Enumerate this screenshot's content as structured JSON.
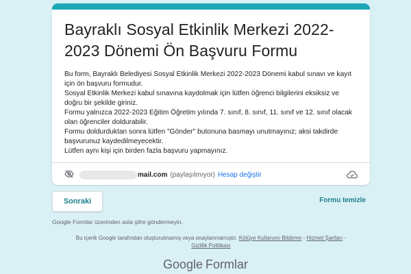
{
  "form": {
    "title": "Bayraklı Sosyal Etkinlik Merkezi 2022-2023 Dönemi Ön Başvuru Formu",
    "description": [
      "Bu form, Bayraklı Belediyesi Sosyal Etkinlik Merkezi 2022-2023 Dönemi kabul sınavı ve kayıt için ön başvuru formudur.",
      "Sosyal Etkinlik Merkezi kabul sınavına kaydolmak için lütfen öğrenci bilgilerini eksiksiz ve doğru bir şekilde giriniz.",
      "Formu yalnızca 2022-2023 Eğitim Öğretim yılında 7. sınıf, 8. sınıf, 11. sınıf ve 12. sınıf olacak olan öğrenciler doldurabilir.",
      "Formu doldurduktan sonra lütfen \"Gönder\" butonuna basmayı unutmayınız; aksi takdirde başvurunuz kaydedilmeyecektir.",
      "Lütfen aynı kişi için birden fazla başvuru yapmayınız."
    ]
  },
  "account": {
    "email_suffix": "mail.com",
    "not_shared": "(paylaşılmıyor)",
    "switch_account": "Hesap değiştir"
  },
  "actions": {
    "next": "Sonraki",
    "clear": "Formu temizle"
  },
  "footer": {
    "password_warning": "Google Formlar üzerinden asla şifre göndermeyin.",
    "disclaimer_text": "Bu içerik Google tarafından oluşturulmamış veya onaylanmamıştır.",
    "report_abuse": "Kötüye Kullanımı Bildirme",
    "terms": "Hizmet Şartları",
    "privacy": "Gizlilik Politikası",
    "brand_google": "Google",
    "brand_forms": "Formlar"
  },
  "colors": {
    "accent": "#1aa8b8",
    "background": "#d9f0f5",
    "link": "#1a73e8"
  }
}
